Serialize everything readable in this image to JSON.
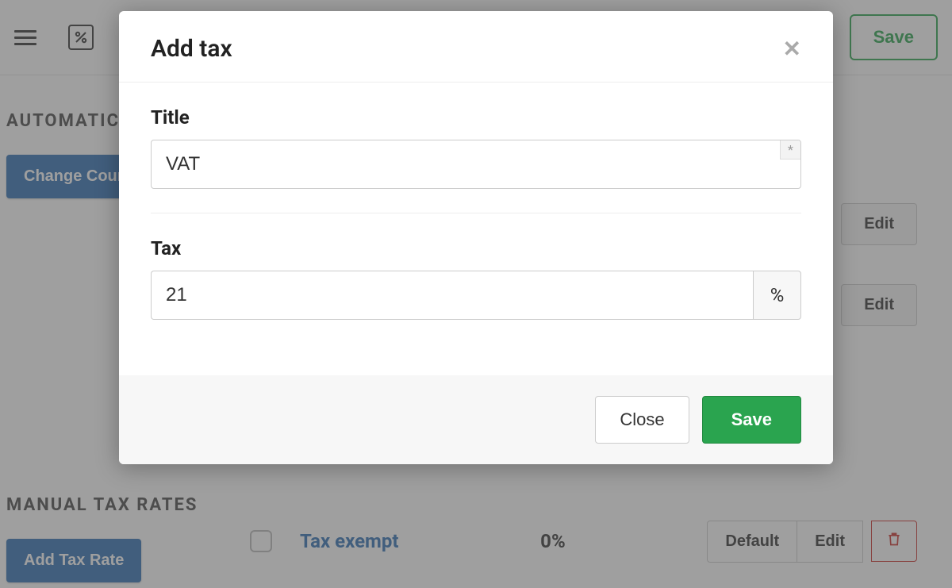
{
  "header": {
    "save_label": "Save"
  },
  "sections": {
    "automatic_title": "AUTOMATIC TAX RATES",
    "manual_title": "MANUAL TAX RATES",
    "change_country_label": "Change Country",
    "add_tax_rate_label": "Add Tax Rate",
    "edit_label": "Edit"
  },
  "tax_row": {
    "name": "Tax exempt",
    "rate": "0%",
    "default_label": "Default",
    "edit_label": "Edit"
  },
  "modal": {
    "title": "Add tax",
    "title_field_label": "Title",
    "title_value": "VAT",
    "tax_field_label": "Tax",
    "tax_value": "21",
    "tax_unit": "%",
    "close_label": "Close",
    "save_label": "Save",
    "required_marker": "*"
  }
}
